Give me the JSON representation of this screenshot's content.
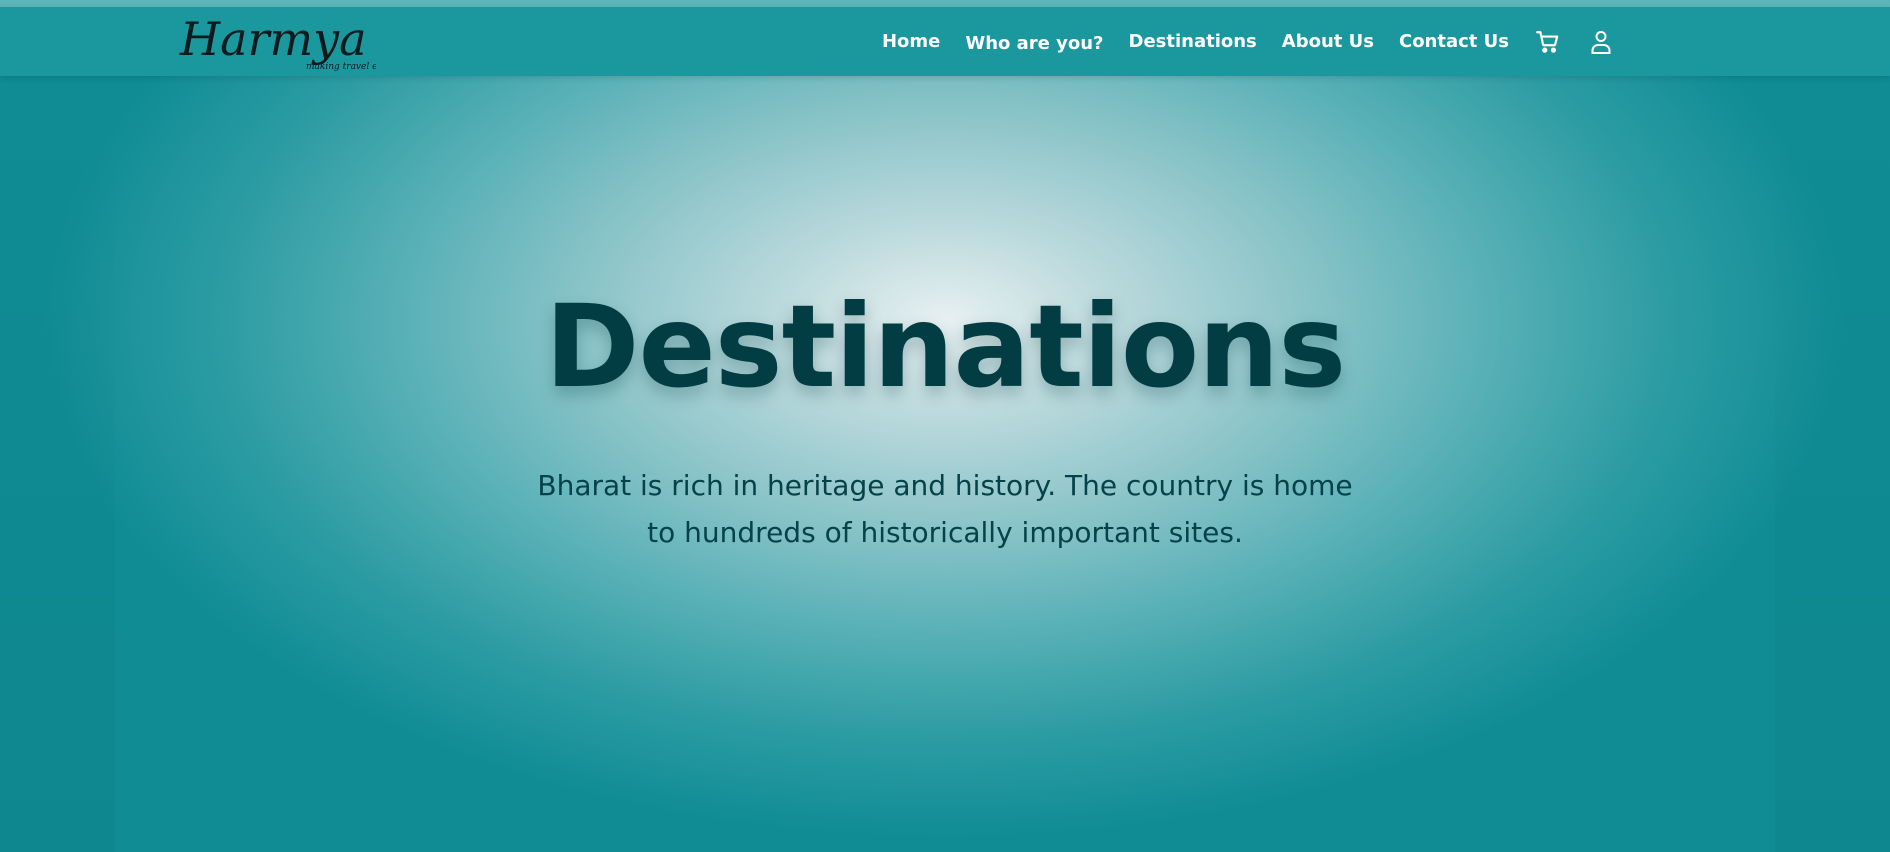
{
  "brand": {
    "name": "Harmya",
    "tagline": "making travel easy"
  },
  "nav": {
    "items": [
      {
        "label": "Home"
      },
      {
        "label": "Who are you?"
      },
      {
        "label": "Destinations"
      },
      {
        "label": "About Us"
      },
      {
        "label": "Contact Us"
      }
    ],
    "icons": [
      "cart-icon",
      "user-icon"
    ]
  },
  "hero": {
    "title": "Destinations",
    "description": "Bharat is rich in heritage and history. The country is home to hundreds of historically important sites."
  },
  "colors": {
    "navbar": "#1b979e",
    "accent_dark": "#033d44",
    "text_light": "#ffffff"
  }
}
